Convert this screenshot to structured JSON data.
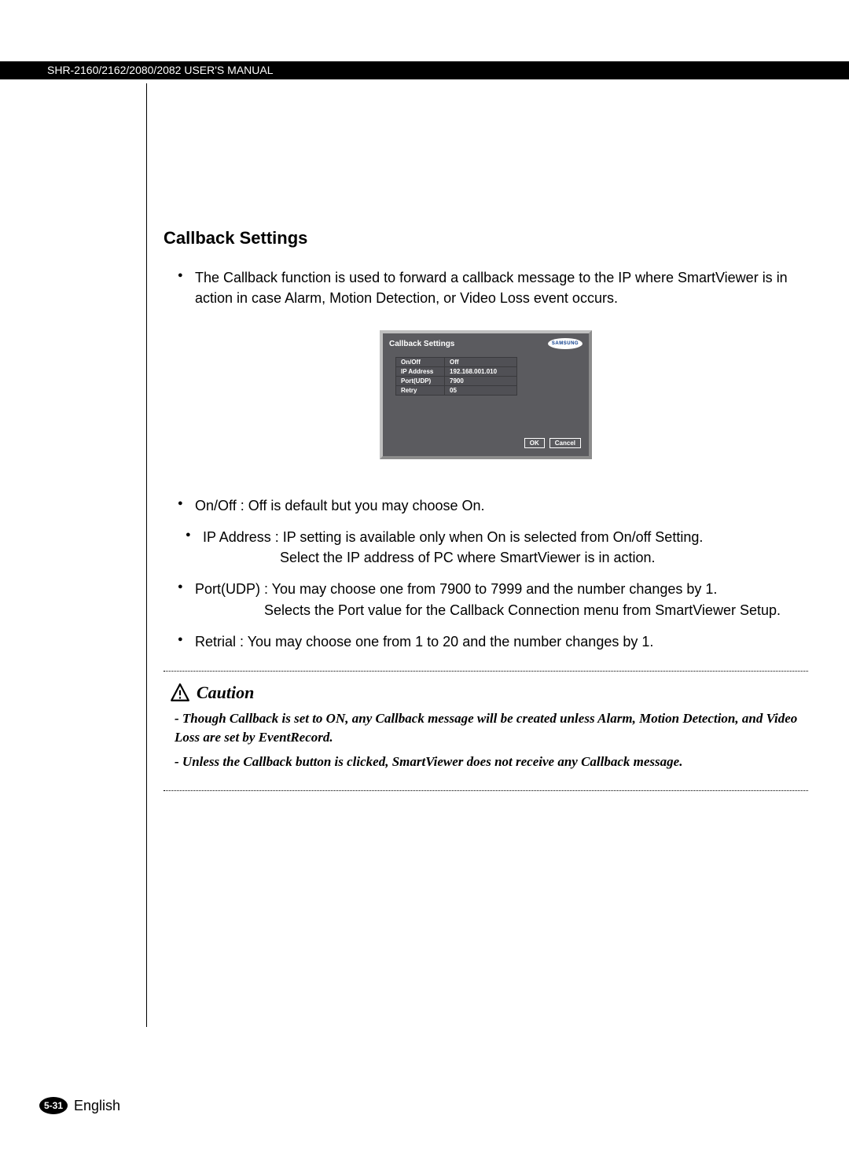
{
  "header": {
    "manual_title": "SHR-2160/2162/2080/2082 USER'S MANUAL"
  },
  "section": {
    "title": "Callback Settings",
    "intro": "The Callback function is used to forward a callback message to the IP where SmartViewer is in action in case Alarm, Motion Detection, or Video Loss event occurs.",
    "bullets": {
      "onoff": "On/Off : Off is default but you may choose On.",
      "ip_line1": "IP Address : IP setting is available only when On is selected from On/off Setting.",
      "ip_line2": "Select the IP address of PC where SmartViewer is in action.",
      "port_line1": "Port(UDP) : You may choose one from 7900 to 7999 and the number changes by 1.",
      "port_line2": "Selects the Port value for the Callback Connection menu from SmartViewer Setup.",
      "retrial": "Retrial : You may choose one from 1 to 20 and the number changes by 1."
    }
  },
  "dialog": {
    "title": "Callback Settings",
    "brand": "SAMSUNG",
    "rows": [
      {
        "label": "On/Off",
        "value": "Off"
      },
      {
        "label": "IP Address",
        "value": "192.168.001.010"
      },
      {
        "label": "Port(UDP)",
        "value": "7900"
      },
      {
        "label": "Retry",
        "value": "05"
      }
    ],
    "ok": "OK",
    "cancel": "Cancel"
  },
  "caution": {
    "heading": "Caution",
    "item1": "- Though Callback is set to ON, any Callback message will be created unless Alarm, Motion Detection, and Video Loss are set by EventRecord.",
    "item2": "- Unless the Callback button is clicked, SmartViewer does not receive any Callback message."
  },
  "footer": {
    "page": "5-31",
    "lang": "English"
  }
}
